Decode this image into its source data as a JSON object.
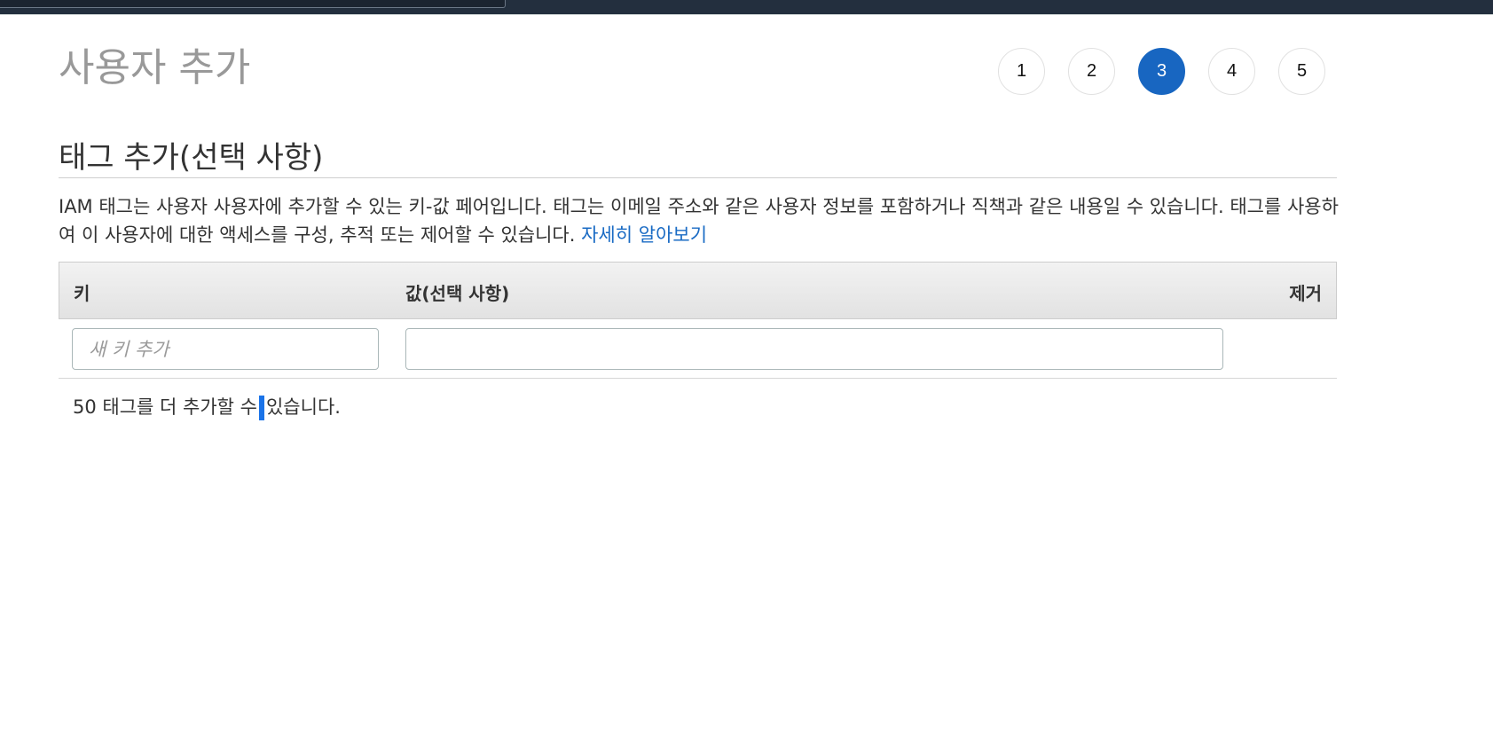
{
  "page": {
    "title": "사용자 추가"
  },
  "steps": [
    {
      "label": "1",
      "active": false
    },
    {
      "label": "2",
      "active": false
    },
    {
      "label": "3",
      "active": true
    },
    {
      "label": "4",
      "active": false
    },
    {
      "label": "5",
      "active": false
    }
  ],
  "section": {
    "title": "태그 추가(선택 사항)",
    "description": "IAM 태그는 사용자 사용자에 추가할 수 있는 키-값 페어입니다. 태그는 이메일 주소와 같은 사용자 정보를 포함하거나 직책과 같은 내용일 수 있습니다. 태그를 사용하여 이 사용자에 대한 액세스를 구성, 추적 또는 제어할 수 있습니다.",
    "learn_more": "자세히 알아보기"
  },
  "table": {
    "headers": {
      "key": "키",
      "value": "값(선택 사항)",
      "remove": "제거"
    },
    "new_row": {
      "key_placeholder": "새 키 추가",
      "key_value": "",
      "value_value": ""
    }
  },
  "footer": {
    "remaining_before": "50 태그를 더 추가할 수",
    "remaining_after": "있습니다."
  },
  "colors": {
    "accent": "#1866c1",
    "link": "#1a6bc4",
    "top_bar": "#232f3e"
  }
}
